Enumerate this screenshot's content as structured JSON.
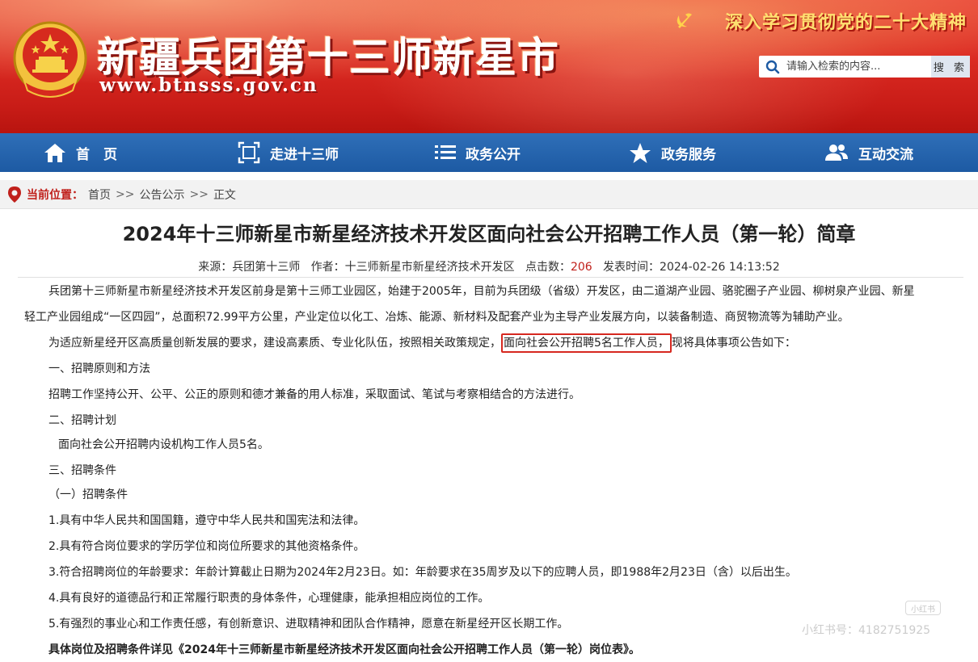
{
  "header": {
    "site_title": "新疆兵团第十三师新星市",
    "site_url": "www.btnsss.gov.cn",
    "slogan": "深入学习贯彻党的二十大精神",
    "search": {
      "placeholder": "请输入检索的内容...",
      "button_label": "搜 索"
    }
  },
  "nav": {
    "items": [
      {
        "label": "首　页",
        "icon": "home-icon"
      },
      {
        "label": "走进十三师",
        "icon": "frame-icon"
      },
      {
        "label": "政务公开",
        "icon": "list-icon"
      },
      {
        "label": "政务服务",
        "icon": "star-icon"
      },
      {
        "label": "互动交流",
        "icon": "users-icon"
      }
    ]
  },
  "breadcrumb": {
    "label": "当前位置：",
    "items": [
      "首页",
      "公告公示",
      "正文"
    ],
    "separator": ">>"
  },
  "article": {
    "title": "2024年十三师新星市新星经济技术开发区面向社会公开招聘工作人员（第一轮）简章",
    "meta": {
      "source_label": "来源：",
      "source": "兵团第十三师",
      "author_label": "作者：",
      "author": "十三师新星市新星经济技术开发区",
      "hits_label": "点击数：",
      "hits": "206",
      "date_label": "发表时间：",
      "date": "2024-02-26 14:13:52"
    },
    "p1_line1": "兵团第十三师新星市新星经济技术开发区前身是第十三师工业园区，始建于2005年，目前为兵团级（省级）开发区，由二道湖产业园、骆驼圈子产业园、柳树泉产业园、新星",
    "p1_line2": "轻工产业园组成“一区四园”，总面积72.99平方公里，产业定位以化工、冶炼、能源、新材料及配套产业为主导产业发展方向，以装备制造、商贸物流等为辅助产业。",
    "p2_before": "为适应新星经开区高质量创新发展的要求，建设高素质、专业化队伍，按照相关政策规定，",
    "p2_highlight": "面向社会公开招聘5名工作人员，",
    "p2_after": "现将具体事项公告如下：",
    "s1_heading": "一、招聘原则和方法",
    "s1_text": "招聘工作坚持公开、公平、公正的原则和德才兼备的用人标准，采取面试、笔试与考察相结合的方法进行。",
    "s2_heading": "二、招聘计划",
    "s2_text": "面向社会公开招聘内设机构工作人员5名。",
    "s3_heading": "三、招聘条件",
    "s3_sub": "（一）招聘条件",
    "cond1": "1.具有中华人民共和国国籍，遵守中华人民共和国宪法和法律。",
    "cond2": "2.具有符合岗位要求的学历学位和岗位所要求的其他资格条件。",
    "cond3": "3.符合招聘岗位的年龄要求：年龄计算截止日期为2024年2月23日。如：年龄要求在35周岁及以下的应聘人员，即1988年2月23日（含）以后出生。",
    "cond4": "4.具有良好的道德品行和正常履行职责的身体条件，心理健康，能承担相应岗位的工作。",
    "cond5": "5.有强烈的事业心和工作责任感，有创新意识、进取精神和团队合作精神，愿意在新星经开区长期工作。",
    "final_note": "具体岗位及招聘条件详见《2024年十三师新星市新星经济技术开发区面向社会公开招聘工作人员（第一轮）岗位表》。"
  },
  "watermark": {
    "logo_text": "小红书",
    "text": "小红书号：4182751925"
  },
  "colors": {
    "banner_red": "#db2a22",
    "nav_blue": "#1d5aa3",
    "accent_red": "#c0201b",
    "slogan_yellow": "#ffe070"
  }
}
